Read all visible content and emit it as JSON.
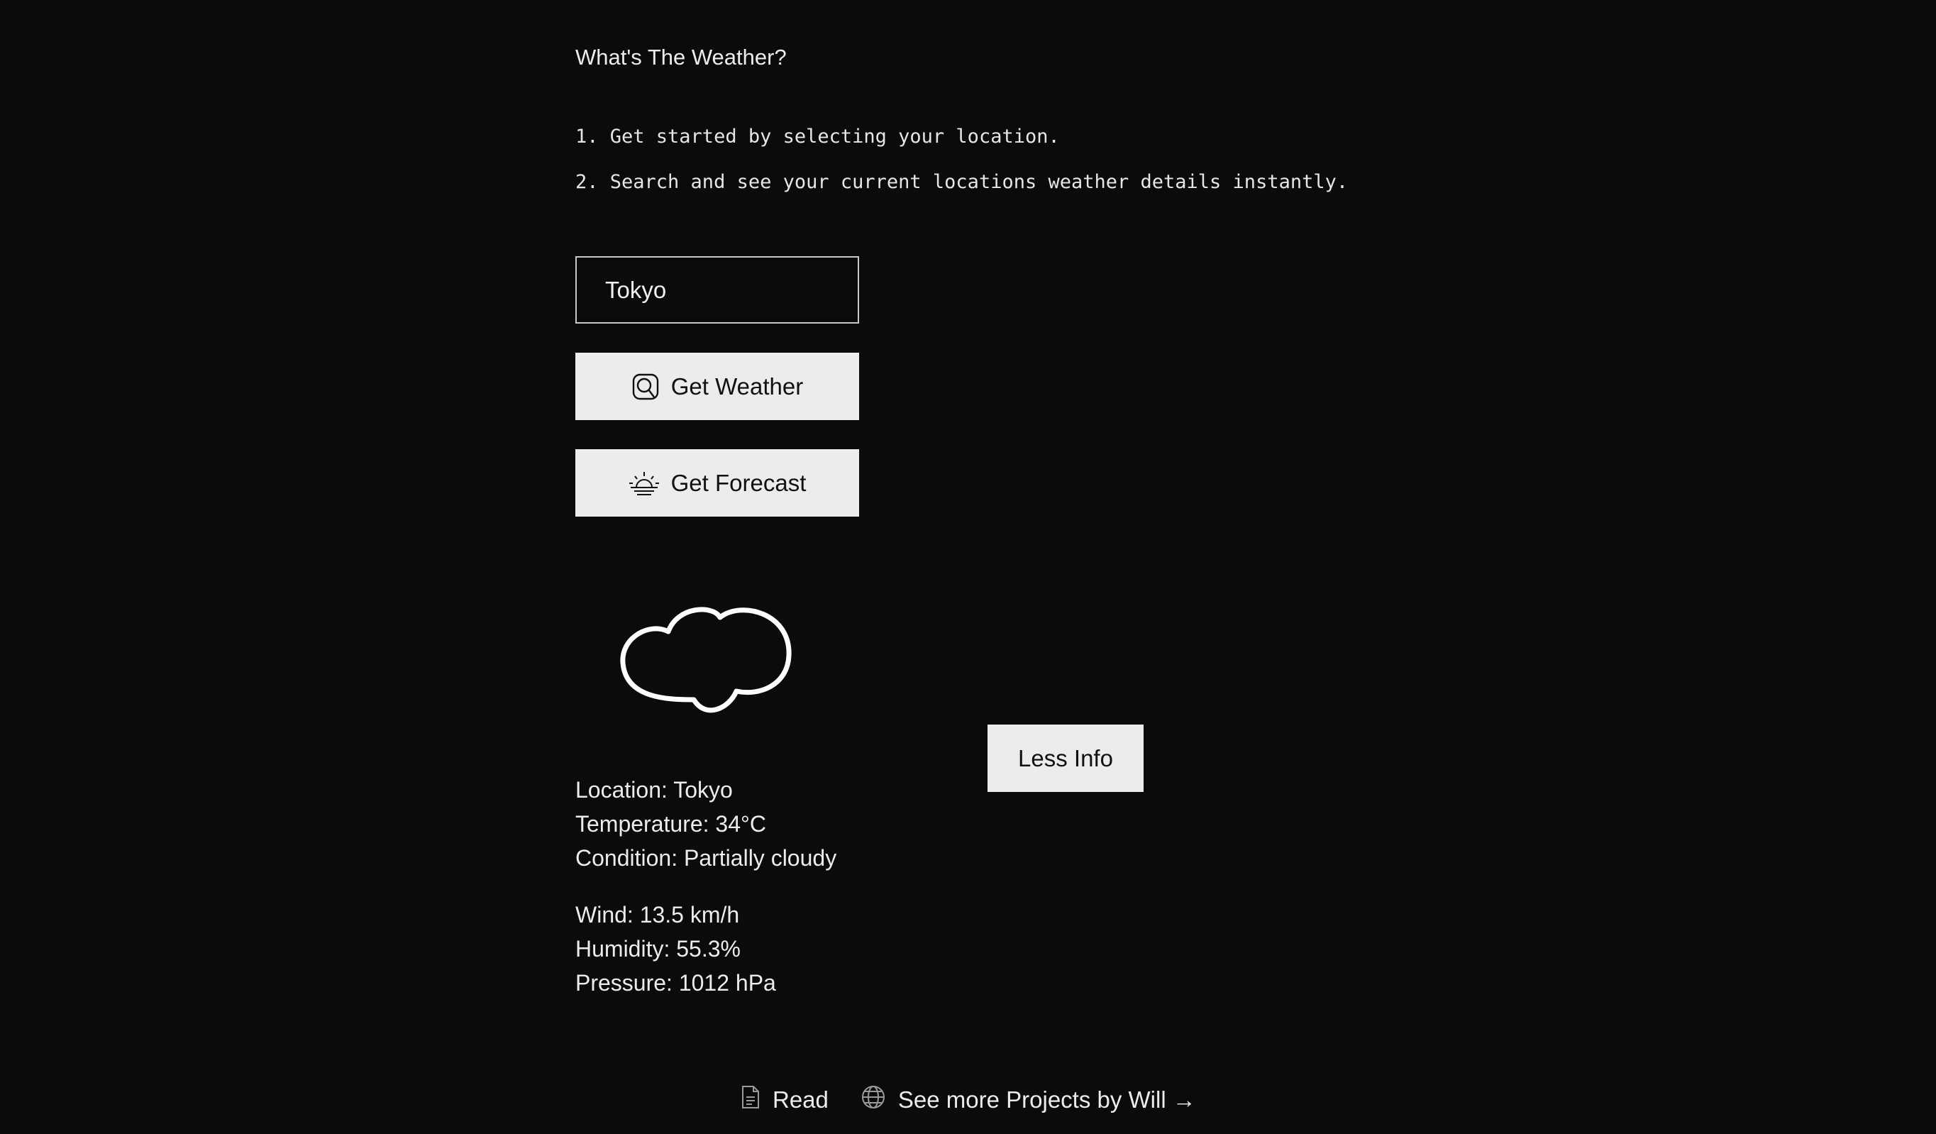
{
  "app": {
    "title": "What's The Weather?"
  },
  "steps": [
    "1. Get started by selecting your location.",
    "2. Search and see your current locations weather details instantly."
  ],
  "search": {
    "value": "Tokyo",
    "placeholder": ""
  },
  "buttons": {
    "get_weather": {
      "label": "Get Weather",
      "icon": "search-icon"
    },
    "get_forecast": {
      "label": "Get Forecast",
      "icon": "sunrise-icon"
    },
    "less_info": {
      "label": "Less Info"
    }
  },
  "weather": {
    "icon": "cloud-icon",
    "location": "Location: Tokyo",
    "temperature": "Temperature: 34°C",
    "condition": "Condition: Partially cloudy",
    "wind": "Wind: 13.5 km/h",
    "humidity": "Humidity: 55.3%",
    "pressure": "Pressure: 1012 hPa"
  },
  "footer": {
    "read_label": "Read",
    "read_icon": "document-icon",
    "projects_label": "See more Projects by Will →",
    "projects_icon": "globe-icon"
  },
  "colors": {
    "background": "#0b0b0b",
    "text": "#ececec",
    "button_bg": "#ececec",
    "button_text": "#111111"
  }
}
